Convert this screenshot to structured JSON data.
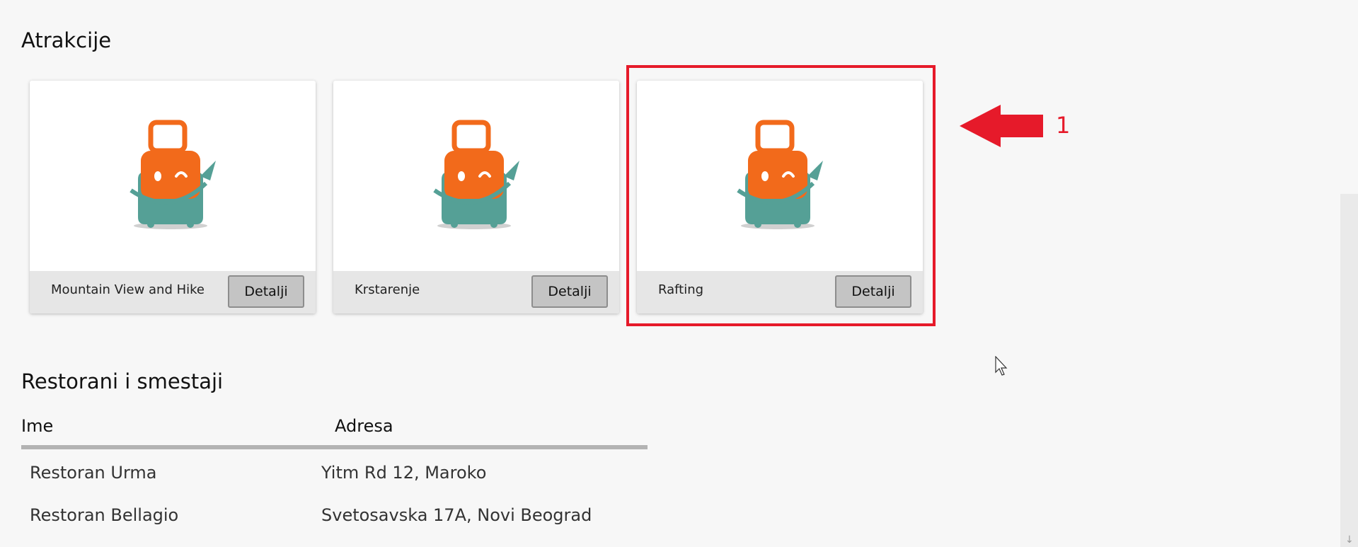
{
  "sections": {
    "attractions_title": "Atrakcije",
    "restaurants_title": "Restorani i smestaji"
  },
  "attractions": [
    {
      "name": "Mountain View and Hike",
      "button": "Detalji"
    },
    {
      "name": "Krstarenje",
      "button": "Detalji"
    },
    {
      "name": "Rafting",
      "button": "Detalji"
    }
  ],
  "annotation": {
    "label": "1",
    "color": "#e61a2a"
  },
  "table": {
    "headers": [
      "Ime",
      "Adresa"
    ],
    "rows": [
      [
        "Restoran Urma",
        "Yitm Rd 12, Maroko"
      ],
      [
        "Restoran Bellagio",
        "Svetosavska 17A, Novi Beograd"
      ]
    ]
  },
  "colors": {
    "suitcase_orange": "#f26a1b",
    "suitcase_teal": "#55a096",
    "button_bg": "#c4c4c4",
    "card_footer": "#e6e6e6"
  }
}
